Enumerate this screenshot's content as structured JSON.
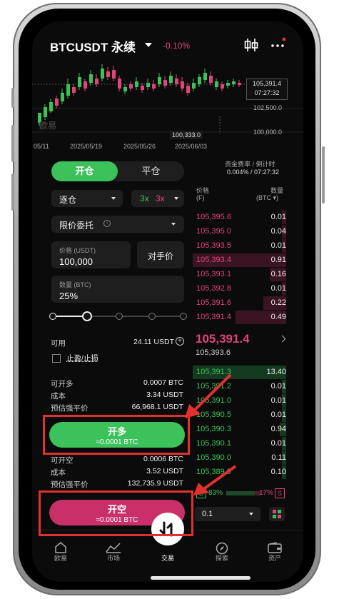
{
  "header": {
    "pair": "BTCUSDT 永续",
    "change": "-0.10%",
    "icon_chart_mode": "candlestick-icon",
    "icon_more": "more-icon"
  },
  "chart": {
    "last_price": "105,391.4",
    "countdown": "07:27:32",
    "level_high": "102,500.0",
    "level_low": "100,000.0",
    "low_marker": "100,333.0",
    "watermark": "欧易",
    "dates": [
      "05/11",
      "2025/05/19",
      "2025/05/26",
      "2025/06/03"
    ]
  },
  "funding": {
    "label": "资金费率 / 倒计时",
    "value": "0.004% / 07:27:32"
  },
  "order_form": {
    "tab_open": "开仓",
    "tab_close": "平仓",
    "margin_mode": "逐仓",
    "leverage_long": "3x",
    "leverage_short": "3x",
    "order_type": "限价委托",
    "price_label": "价格 (USDT)",
    "price_value": "100,000",
    "counterparty_price": "对手价",
    "qty_label": "数量 (BTC)",
    "qty_value": "25%",
    "slider_percent": 25,
    "available_label": "可用",
    "available_value": "24.11 USDT",
    "tpsl_label": "止盈/止损",
    "long_rows": [
      {
        "label": "可开多",
        "value": "0.0007 BTC"
      },
      {
        "label": "成本",
        "value": "3.34 USDT"
      },
      {
        "label": "预估强平价",
        "value": "66,968.1 USDT"
      }
    ],
    "long_button": "开多",
    "long_button_sub": "≈0.0001 BTC",
    "short_rows": [
      {
        "label": "可开空",
        "value": "0.0006 BTC"
      },
      {
        "label": "成本",
        "value": "3.52 USDT"
      },
      {
        "label": "预估强平价",
        "value": "132,735.9 USDT"
      }
    ],
    "short_button": "开空",
    "short_button_sub": "≈0.0001 BTC"
  },
  "orderbook": {
    "col_price": "价格",
    "col_price_unit": "(F)",
    "col_qty": "数量",
    "col_qty_unit": "(BTC ▾)",
    "asks": [
      {
        "price": "105,395.6",
        "qty": "0.01"
      },
      {
        "price": "105,395.0",
        "qty": "0.04"
      },
      {
        "price": "105,393.5",
        "qty": "0.01"
      },
      {
        "price": "105,393.4",
        "qty": "0.91"
      },
      {
        "price": "105,393.1",
        "qty": "0.16"
      },
      {
        "price": "105,392.8",
        "qty": "0.01"
      },
      {
        "price": "105,391.6",
        "qty": "0.22"
      },
      {
        "price": "105,391.4",
        "qty": "0.49"
      }
    ],
    "mid_price": "105,391.4",
    "mark_price": "105,393.6",
    "bids": [
      {
        "price": "105,391.3",
        "qty": "13.40"
      },
      {
        "price": "105,391.2",
        "qty": "0.01"
      },
      {
        "price": "105,391.0",
        "qty": "0.01"
      },
      {
        "price": "105,390.5",
        "qty": "0.01"
      },
      {
        "price": "105,390.3",
        "qty": "0.94"
      },
      {
        "price": "105,390.1",
        "qty": "0.01"
      },
      {
        "price": "105,390.0",
        "qty": "0.11"
      },
      {
        "price": "105,389.9",
        "qty": "0.10"
      }
    ],
    "buy_label": "B",
    "buy_ratio": "83%",
    "sell_ratio": "17%",
    "sell_label": "S",
    "depth_value": "0.1"
  },
  "nav": {
    "items": [
      {
        "label": "欧易",
        "icon": "home-icon"
      },
      {
        "label": "市场",
        "icon": "market-icon"
      },
      {
        "label": "交易",
        "icon": "trade-icon"
      },
      {
        "label": "探索",
        "icon": "explore-icon"
      },
      {
        "label": "资产",
        "icon": "wallet-icon"
      }
    ]
  },
  "colors": {
    "green": "#3bc25a",
    "red": "#c9306a",
    "annotation": "#e0312f"
  }
}
